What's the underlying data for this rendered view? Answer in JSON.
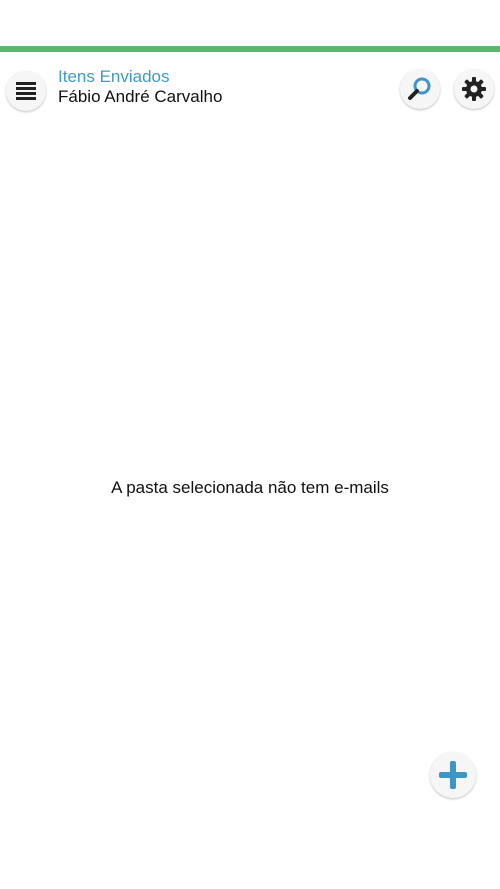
{
  "header": {
    "folder_title": "Itens Enviados",
    "account_name": "Fábio André Carvalho",
    "menu_icon": "hamburger-menu-icon",
    "search_icon": "search-icon",
    "settings_icon": "gear-icon"
  },
  "main": {
    "empty_message": "A pasta selecionada não tem e-mails"
  },
  "fab": {
    "icon": "plus-icon"
  },
  "colors": {
    "accent_green": "#5fb56a",
    "folder_title_blue": "#3d9bc7",
    "icon_blue": "#3f95c6"
  }
}
